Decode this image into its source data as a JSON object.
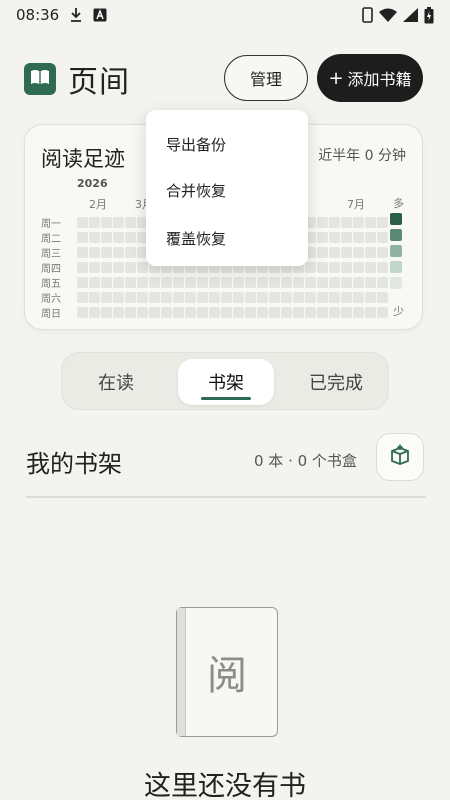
{
  "status_bar": {
    "time": "08:36",
    "icons": [
      "download-icon",
      "keyboard-a-icon",
      "phone-icon",
      "wifi-icon",
      "signal-icon",
      "battery-charging-icon"
    ]
  },
  "header": {
    "title": "页间",
    "manage_label": "管理",
    "add_label": "添加书籍",
    "plus_glyph": "+"
  },
  "footprint": {
    "title": "阅读足迹",
    "summary": "近半年 0 分钟",
    "year": "2026",
    "months": [
      "2月",
      "3月",
      "7月"
    ],
    "weekdays": [
      "周一",
      "周二",
      "周三",
      "周四",
      "周五",
      "周六",
      "周日"
    ],
    "legend_more": "多",
    "legend_less": "少",
    "legend_colors": [
      "#2d5e4a",
      "#5a8a74",
      "#8fb3a2",
      "#c3d6cc",
      "#e3e7e2"
    ],
    "empty_cell_color": "#e5e5e0"
  },
  "dropdown": {
    "items": [
      "导出备份",
      "合并恢复",
      "覆盖恢复"
    ]
  },
  "tabs": {
    "items": [
      "在读",
      "书架",
      "已完成"
    ],
    "active": "书架"
  },
  "shelf": {
    "title": "我的书架",
    "count": "0 本 · 0 个书盒"
  },
  "empty_state": {
    "book_char": "阅",
    "message": "这里还没有书"
  },
  "colors": {
    "accent": "#2e6b52",
    "primary_button": "#1d1d1d",
    "background": "#f3f3ef"
  }
}
